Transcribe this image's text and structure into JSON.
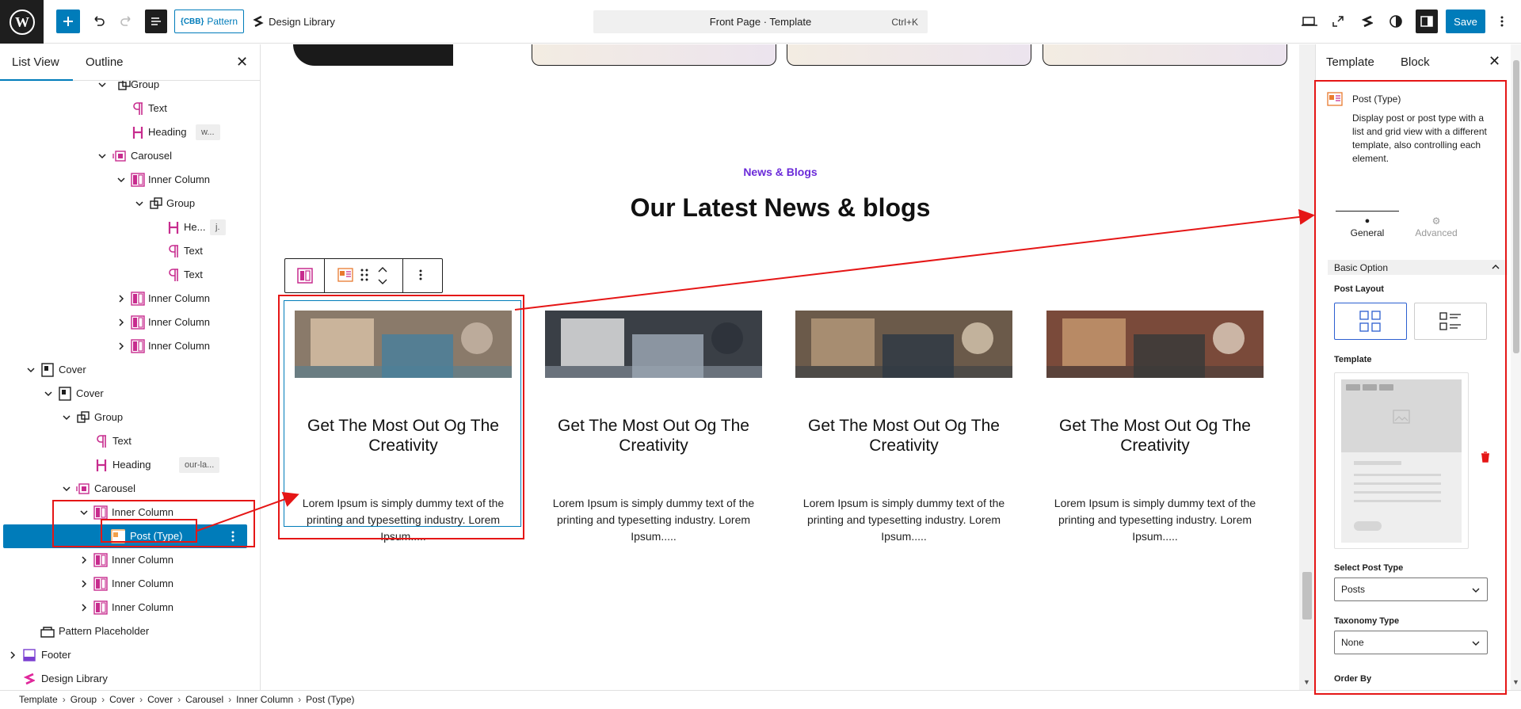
{
  "topbar": {
    "pattern_label": "Pattern",
    "pattern_prefix": "{CBB}",
    "design_library_label": "Design Library",
    "doc_title": "Front Page · Template",
    "shortcut": "Ctrl+K",
    "save_label": "Save"
  },
  "left_panel": {
    "tabs": [
      "List View",
      "Outline"
    ],
    "rows": [
      {
        "label": "Group",
        "chip": ""
      },
      {
        "label": "Text",
        "chip": ""
      },
      {
        "label": "Heading",
        "chip": "w..."
      },
      {
        "label": "Carousel",
        "chip": ""
      },
      {
        "label": "Inner Column",
        "chip": ""
      },
      {
        "label": "Group",
        "chip": ""
      },
      {
        "label": "He...",
        "chip": "j."
      },
      {
        "label": "Text",
        "chip": ""
      },
      {
        "label": "Text",
        "chip": ""
      },
      {
        "label": "Inner Column",
        "chip": ""
      },
      {
        "label": "Inner Column",
        "chip": ""
      },
      {
        "label": "Inner Column",
        "chip": ""
      },
      {
        "label": "Cover",
        "chip": ""
      },
      {
        "label": "Cover",
        "chip": ""
      },
      {
        "label": "Group",
        "chip": ""
      },
      {
        "label": "Text",
        "chip": ""
      },
      {
        "label": "Heading",
        "chip": "our-la..."
      },
      {
        "label": "Carousel",
        "chip": ""
      },
      {
        "label": "Inner Column",
        "chip": ""
      },
      {
        "label": "Post (Type)",
        "chip": ""
      },
      {
        "label": "Inner Column",
        "chip": ""
      },
      {
        "label": "Inner Column",
        "chip": ""
      },
      {
        "label": "Inner Column",
        "chip": ""
      },
      {
        "label": "Pattern Placeholder",
        "chip": ""
      },
      {
        "label": "Footer",
        "chip": ""
      },
      {
        "label": "Design Library",
        "chip": ""
      }
    ]
  },
  "canvas": {
    "eyebrow": "News & Blogs",
    "heading": "Our Latest News & blogs",
    "posts": [
      {
        "title": "Get The Most Out Og The Creativity",
        "excerpt": "Lorem Ipsum is simply dummy text of the printing and typesetting industry. Lorem Ipsum....."
      },
      {
        "title": "Get The Most Out Og The Creativity",
        "excerpt": "Lorem Ipsum is simply dummy text of the printing and typesetting industry. Lorem Ipsum....."
      },
      {
        "title": "Get The Most Out Og The Creativity",
        "excerpt": "Lorem Ipsum is simply dummy text of the printing and typesetting industry. Lorem Ipsum....."
      },
      {
        "title": "Get The Most Out Og The Creativity",
        "excerpt": "Lorem Ipsum is simply dummy text of the printing and typesetting industry. Lorem Ipsum....."
      }
    ]
  },
  "right_panel": {
    "tabs": [
      "Template",
      "Block"
    ],
    "block_name": "Post (Type)",
    "block_desc": "Display post or post type with a list and grid view with a different template, also controlling each element.",
    "subtabs": [
      "General",
      "Advanced"
    ],
    "section": "Basic Option",
    "post_layout_label": "Post Layout",
    "template_label": "Template",
    "post_type_label": "Select Post Type",
    "post_type_value": "Posts",
    "taxonomy_label": "Taxonomy Type",
    "taxonomy_value": "None",
    "order_by_label": "Order By"
  },
  "breadcrumbs": [
    "Template",
    "Group",
    "Cover",
    "Cover",
    "Carousel",
    "Inner Column",
    "Post (Type)"
  ],
  "colors": {
    "accent": "#007cba",
    "annotation": "#e51616",
    "eyebrow": "#6b2bd9",
    "block_icon": "#c72c8e"
  }
}
